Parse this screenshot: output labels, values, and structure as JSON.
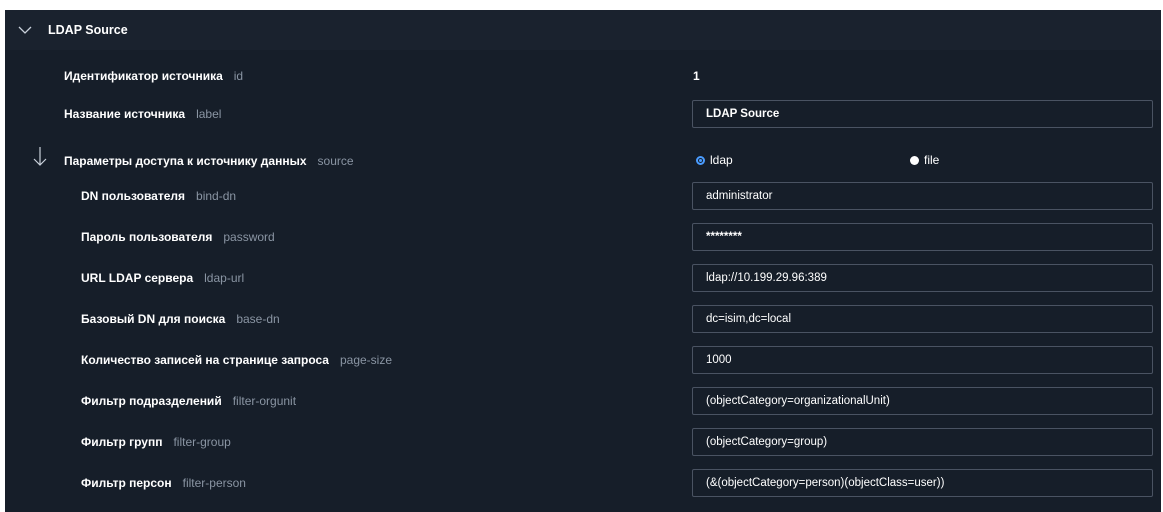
{
  "section": {
    "title": "LDAP Source",
    "icon": "chevron-down-icon"
  },
  "fields": {
    "id": {
      "label": "Идентификатор источника",
      "key": "id",
      "value": "1"
    },
    "label": {
      "label": "Название источника",
      "key": "label",
      "value": "LDAP Source"
    },
    "source": {
      "label": "Параметры доступа к источнику данных",
      "key": "source",
      "options": [
        {
          "label": "ldap",
          "selected": true
        },
        {
          "label": "file",
          "selected": false
        }
      ]
    },
    "bind_dn": {
      "label": "DN пользователя",
      "key": "bind-dn",
      "value": "administrator"
    },
    "password": {
      "label": "Пароль пользователя",
      "key": "password",
      "value": "********"
    },
    "ldap_url": {
      "label": "URL LDAP сервера",
      "key": "ldap-url",
      "value": "ldap://10.199.29.96:389"
    },
    "base_dn": {
      "label": "Базовый DN для поиска",
      "key": "base-dn",
      "value": "dc=isim,dc=local"
    },
    "page_size": {
      "label": "Количество записей на странице запроса",
      "key": "page-size",
      "value": "1000"
    },
    "filter_orgunit": {
      "label": "Фильтр подразделений",
      "key": "filter-orgunit",
      "value": "(objectCategory=organizationalUnit)"
    },
    "filter_group": {
      "label": "Фильтр групп",
      "key": "filter-group",
      "value": "(objectCategory=group)"
    },
    "filter_person": {
      "label": "Фильтр персон",
      "key": "filter-person",
      "value": "(&(objectCategory=person)(objectClass=user))"
    }
  },
  "colors": {
    "background": "#161e29",
    "header": "#1a222e",
    "border": "#4a5362",
    "accent": "#4a9cff",
    "muted": "#8a95a3"
  }
}
